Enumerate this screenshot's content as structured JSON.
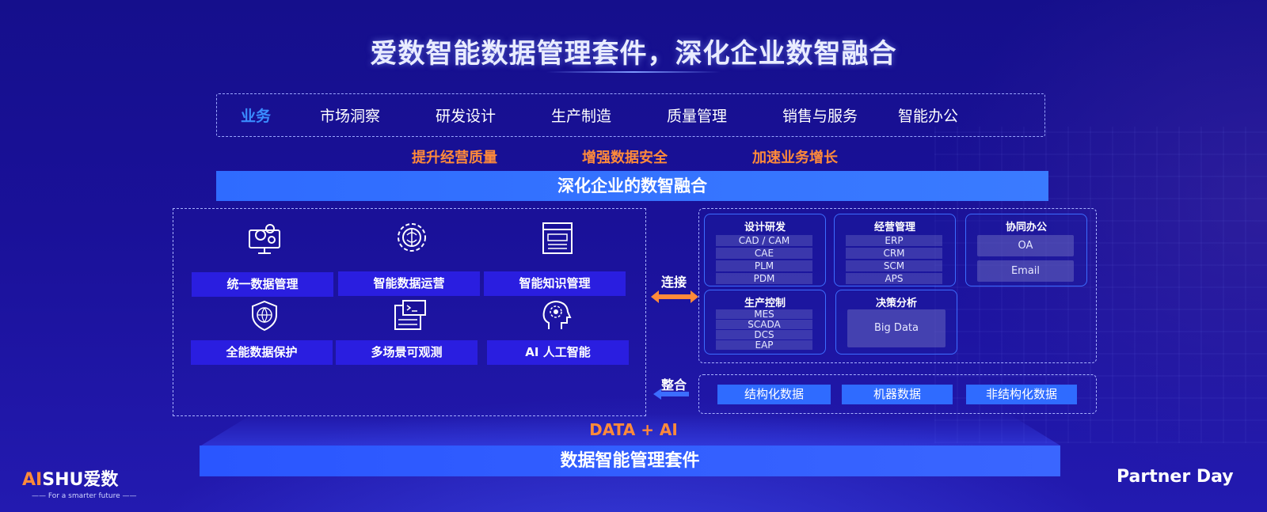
{
  "title": "爱数智能数据管理套件，深化企业数智融合",
  "business": {
    "label": "业务",
    "items": [
      "市场洞察",
      "研发设计",
      "生产制造",
      "质量管理",
      "销售与服务",
      "智能办公"
    ]
  },
  "goals": [
    "提升经营质量",
    "增强数据安全",
    "加速业务增长"
  ],
  "deep_bar": "深化企业的数智融合",
  "capabilities": [
    {
      "label": "统一数据管理",
      "icon": "gears-monitor-icon"
    },
    {
      "label": "智能数据运营",
      "icon": "brain-gear-icon"
    },
    {
      "label": "智能知识管理",
      "icon": "document-window-icon"
    },
    {
      "label": "全能数据保护",
      "icon": "shield-globe-icon"
    },
    {
      "label": "多场景可观测",
      "icon": "terminal-monitor-icon"
    },
    {
      "label": "AI 人工智能",
      "icon": "ai-head-icon"
    }
  ],
  "connect_label": "连接",
  "integrate_label": "整合",
  "systems": {
    "design": {
      "title": "设计研发",
      "items": [
        "CAD / CAM",
        "CAE",
        "PLM",
        "PDM"
      ]
    },
    "business_mgmt": {
      "title": "经营管理",
      "items": [
        "ERP",
        "CRM",
        "SCM",
        "APS"
      ]
    },
    "office": {
      "title": "协同办公",
      "items": [
        "OA",
        "Email"
      ]
    },
    "production": {
      "title": "生产控制",
      "items": [
        "MES",
        "SCADA",
        "DCS",
        "EAP"
      ]
    },
    "decision": {
      "title": "决策分析",
      "items": [
        "Big Data"
      ]
    }
  },
  "data_types": [
    "结构化数据",
    "机器数据",
    "非结构化数据"
  ],
  "data_ai": "DATA + AI",
  "suite": "数据智能管理套件",
  "logo": {
    "brand": "AISHU爱数",
    "ai": "AI",
    "rest": "SHU爱数",
    "tagline": "—— For a smarter future ——"
  },
  "partner_logo": "Partner Day",
  "colors": {
    "orange": "#ff8a3a",
    "blue": "#2f6bff",
    "purple": "#2a1ee0"
  }
}
